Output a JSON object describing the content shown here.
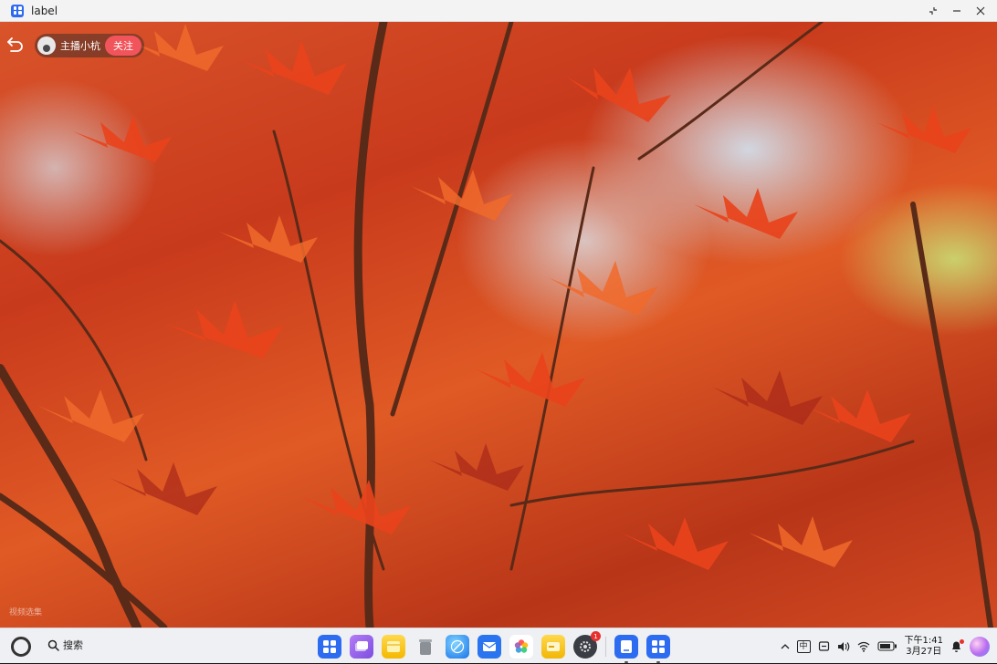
{
  "window": {
    "title": "label"
  },
  "overlay": {
    "host_name": "主播小杭",
    "follow_label": "关注",
    "watermark": "视频选集"
  },
  "taskbar": {
    "search_label": "搜索",
    "dock_items": [
      "app-launcher",
      "multitask",
      "notes",
      "trash",
      "browser",
      "mail",
      "photos",
      "wallet",
      "settings",
      "document",
      "app-store"
    ],
    "settings_badge": "1",
    "tray": {
      "ime_label": "中",
      "clock_time": "下午1:41",
      "clock_date": "3月27日"
    }
  },
  "colors": {
    "follow_button": "#f2545b",
    "taskbar_bg": "#eef0f3",
    "accent_blue": "#2d6cf0"
  }
}
